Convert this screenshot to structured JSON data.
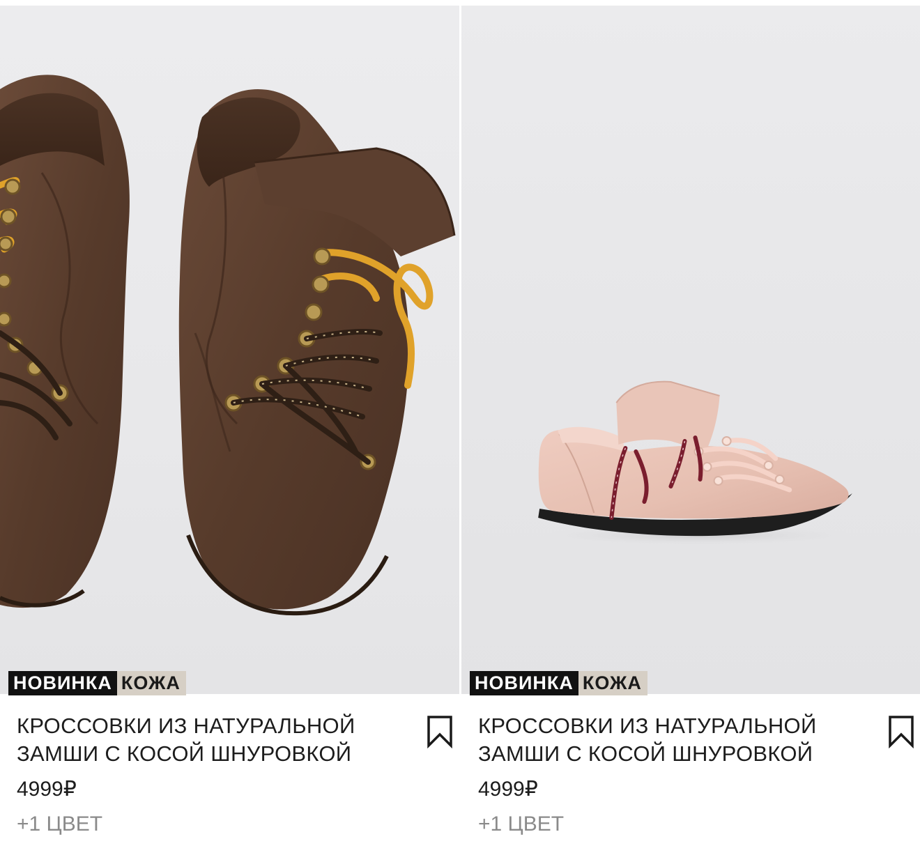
{
  "products": [
    {
      "badge_new": "НОВИНКА",
      "badge_material": "КОЖА",
      "title_line1": "КРОССОВКИ ИЗ НАТУРАЛЬНОЙ",
      "title_line2": "ЗАМШИ С КОСОЙ ШНУРОВКОЙ",
      "price": "4999₽",
      "colors": "+1 ЦВЕТ",
      "icon": "bookmark-icon"
    },
    {
      "badge_new": "НОВИНКА",
      "badge_material": "КОЖА",
      "title_line1": "КРОССОВКИ ИЗ НАТУРАЛЬНОЙ",
      "title_line2": "ЗАМШИ С КОСОЙ ШНУРОВКОЙ",
      "price": "4999₽",
      "colors": "+1 ЦВЕТ",
      "icon": "bookmark-icon"
    }
  ],
  "colors": {
    "badge_new_bg": "#111111",
    "badge_material_bg": "#d6cfc5",
    "suede_brown": "#5a3e2e",
    "suede_pink": "#e8c3b6",
    "lace_yellow": "#e0a22a",
    "lace_burgundy": "#7a1e2e"
  }
}
